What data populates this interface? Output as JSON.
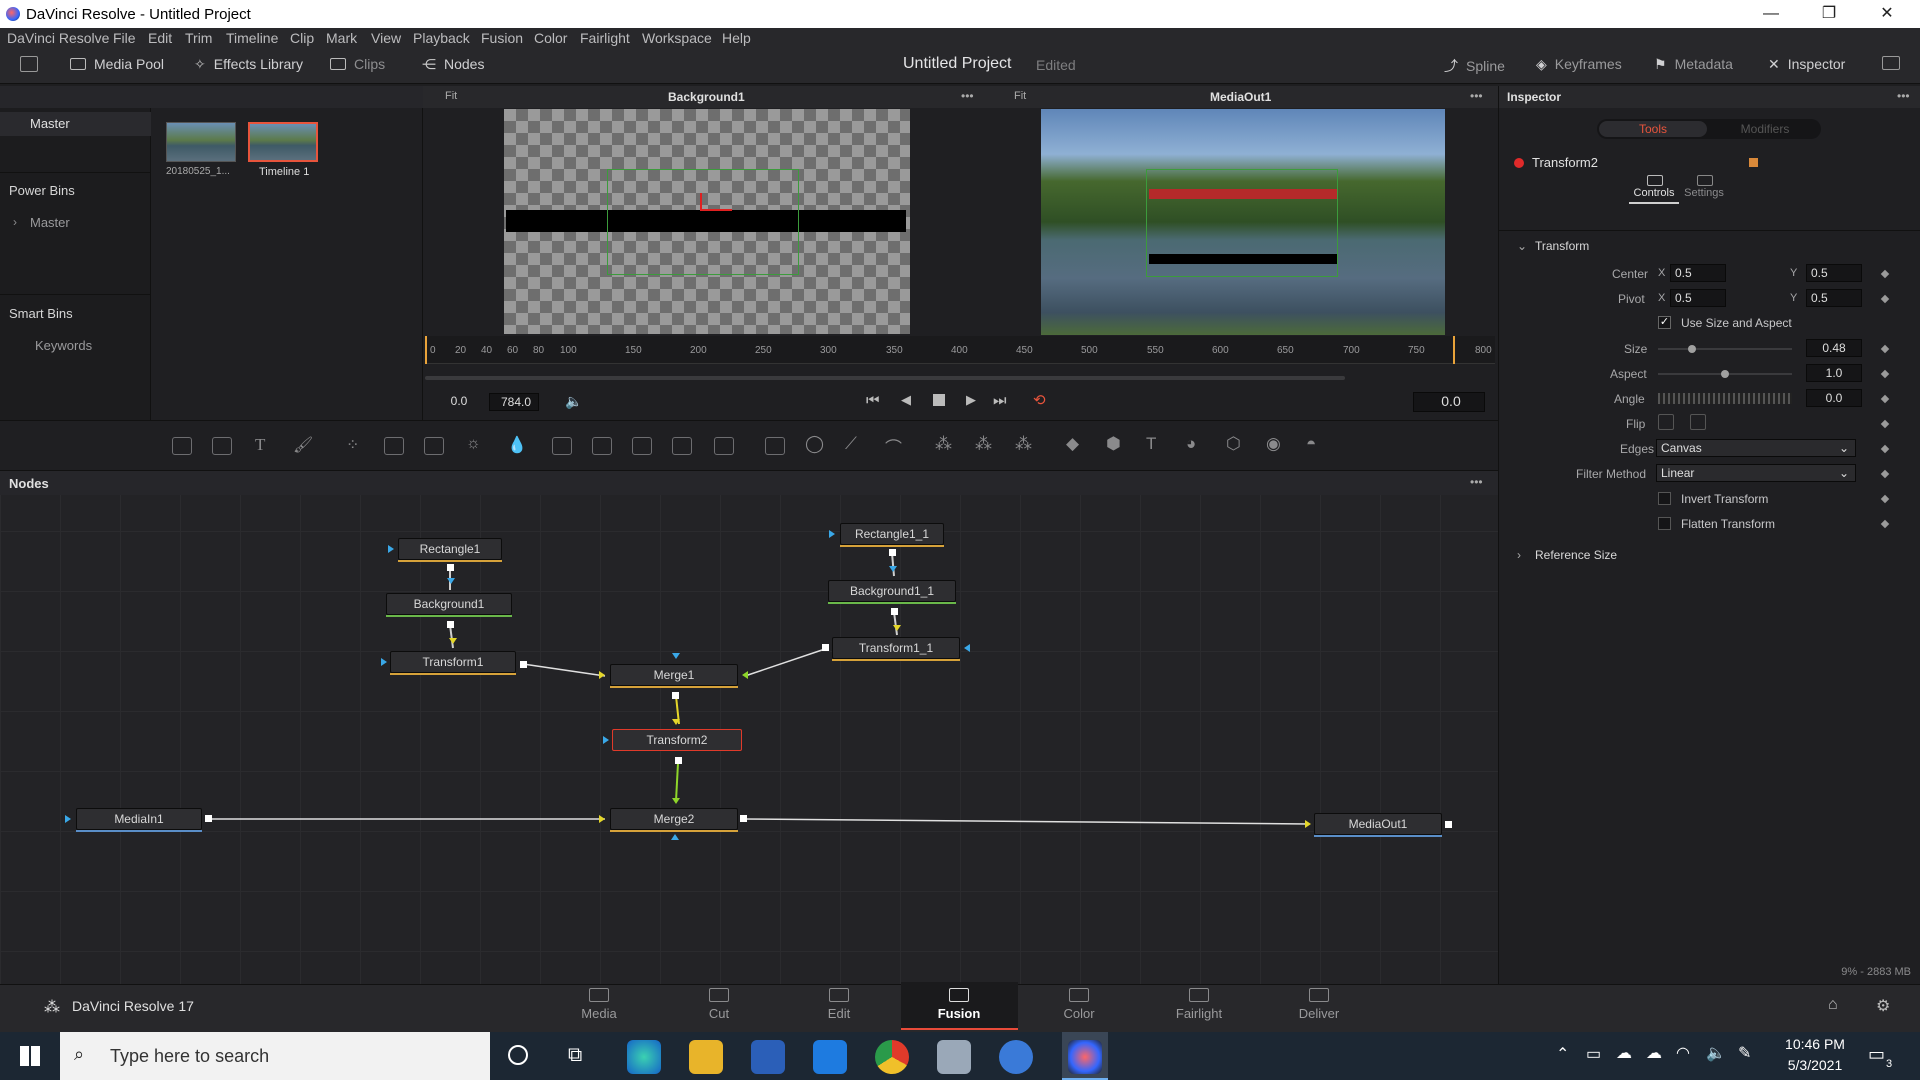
{
  "window": {
    "title": "DaVinci Resolve - Untitled Project",
    "controls": [
      "—",
      "❐",
      "✕"
    ]
  },
  "menu": [
    "DaVinci Resolve",
    "File",
    "Edit",
    "Trim",
    "Timeline",
    "Clip",
    "Mark",
    "View",
    "Playback",
    "Fusion",
    "Color",
    "Fairlight",
    "Workspace",
    "Help"
  ],
  "toolbar": {
    "media_pool": "Media Pool",
    "effects_library": "Effects Library",
    "clips": "Clips",
    "nodes": "Nodes",
    "project_title": "Untitled Project",
    "edited": "Edited",
    "spline": "Spline",
    "keyframes": "Keyframes",
    "metadata": "Metadata",
    "inspector": "Inspector"
  },
  "media_pool": {
    "bin_master": "Master",
    "power_bins": "Power Bins",
    "power_master": "Master",
    "smart_bins": "Smart Bins",
    "keywords": "Keywords",
    "clips": [
      {
        "label": "20180525_1..."
      },
      {
        "label": "Timeline 1"
      }
    ]
  },
  "viewers": {
    "left": {
      "fit": "Fit",
      "title": "Background1",
      "more": "•••"
    },
    "right": {
      "fit": "Fit",
      "title": "MediaOut1",
      "more": "•••"
    },
    "ruler_ticks": [
      "0",
      "20",
      "40",
      "60",
      "80",
      "100",
      "150",
      "200",
      "250",
      "300",
      "350",
      "400",
      "450",
      "500",
      "550",
      "600",
      "650",
      "700",
      "750",
      "800"
    ],
    "time_start": "0.0",
    "time_end": "784.0",
    "current_time": "0.0"
  },
  "nodes_panel": {
    "title": "Nodes",
    "more": "•••",
    "nodes": {
      "rectangle1": "Rectangle1",
      "background1": "Background1",
      "transform1": "Transform1",
      "merge1": "Merge1",
      "transform2": "Transform2",
      "merge2": "Merge2",
      "mediain1": "MediaIn1",
      "mediaout1": "MediaOut1",
      "rectangle1_1": "Rectangle1_1",
      "background1_1": "Background1_1",
      "transform1_1": "Transform1_1"
    }
  },
  "inspector": {
    "title": "Inspector",
    "tabs": [
      "Tools",
      "Modifiers"
    ],
    "node_name": "Transform2",
    "subtabs": [
      "Controls",
      "Settings"
    ],
    "section": "Transform",
    "center_label": "Center",
    "center_x": "0.5",
    "center_y": "0.5",
    "pivot_label": "Pivot",
    "pivot_x": "0.5",
    "pivot_y": "0.5",
    "x": "X",
    "y": "Y",
    "use_size_aspect": "Use Size and Aspect",
    "size_label": "Size",
    "size": "0.48",
    "aspect_label": "Aspect",
    "aspect": "1.0",
    "angle_label": "Angle",
    "angle": "0.0",
    "flip_label": "Flip",
    "edges_label": "Edges",
    "edges": "Canvas",
    "filter_label": "Filter Method",
    "filter": "Linear",
    "invert": "Invert Transform",
    "flatten": "Flatten Transform",
    "reference_size": "Reference Size",
    "memory": "9% - 2883 MB"
  },
  "pages": {
    "app_name": "DaVinci Resolve 17",
    "tabs": [
      "Media",
      "Cut",
      "Edit",
      "Fusion",
      "Color",
      "Fairlight",
      "Deliver"
    ],
    "active": "Fusion"
  },
  "taskbar": {
    "search_placeholder": "Type here to search",
    "time": "10:46 PM",
    "date": "5/3/2021",
    "notifications": "3"
  },
  "colors": {
    "accent": "#e85a3a",
    "active_tab": "#e84b3a",
    "panel_bg": "#1f1f22",
    "header_bg": "#28282b"
  }
}
